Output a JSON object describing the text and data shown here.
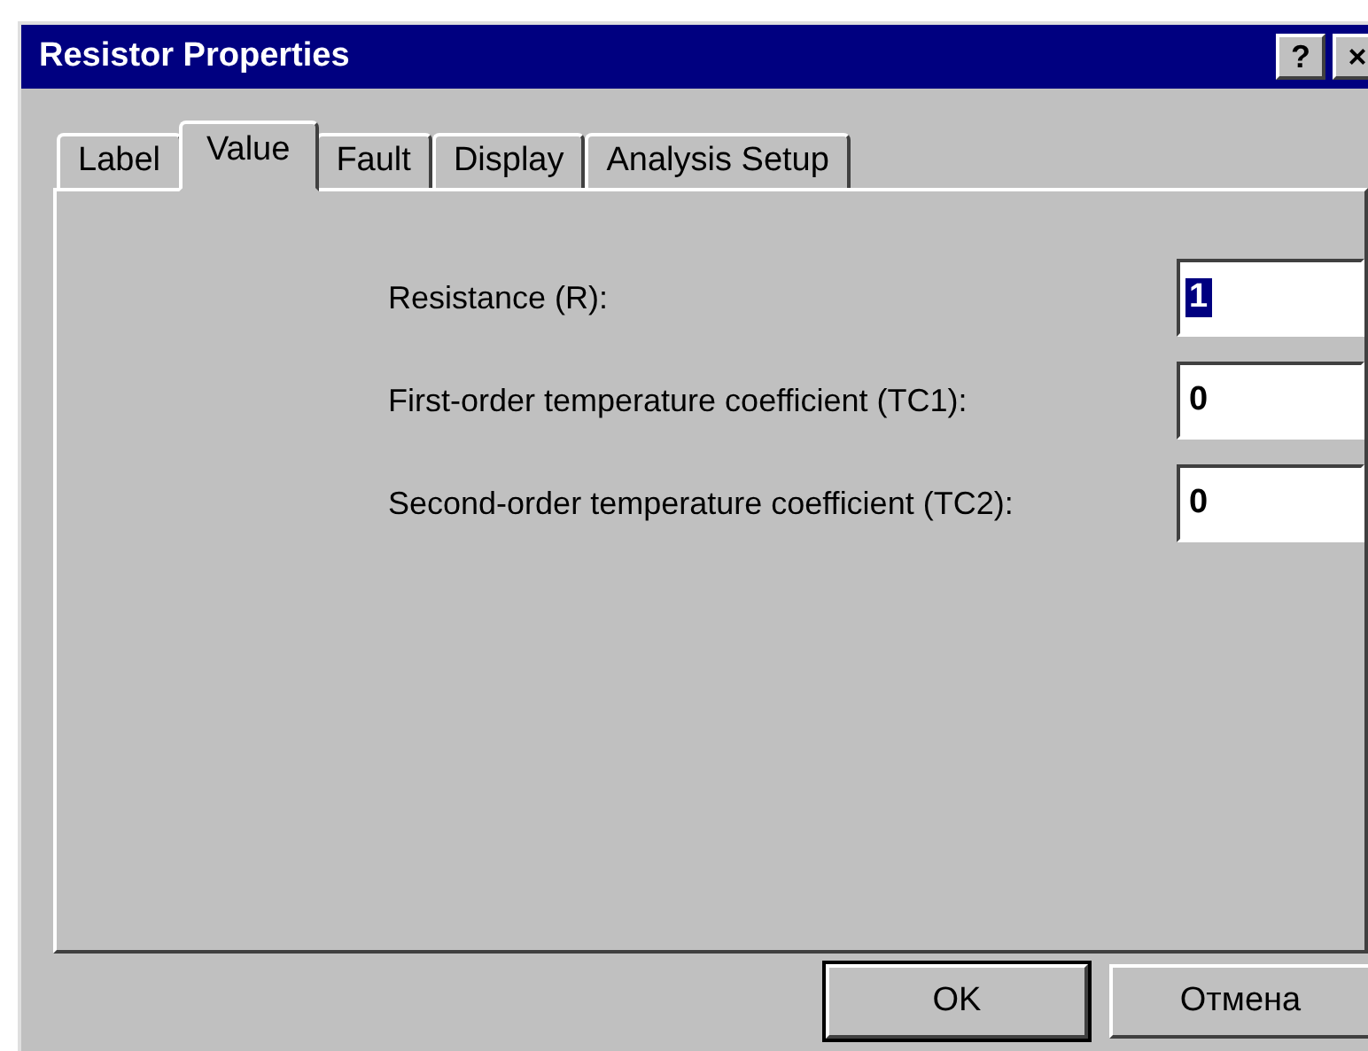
{
  "window": {
    "title": "Resistor Properties",
    "title_buttons": [
      "?",
      "×"
    ]
  },
  "tabs": [
    {
      "label": "Label",
      "selected": false
    },
    {
      "label": "Value",
      "selected": true
    },
    {
      "label": "Fault",
      "selected": false
    },
    {
      "label": "Display",
      "selected": false
    },
    {
      "label": "Analysis Setup",
      "selected": false
    }
  ],
  "fields": [
    {
      "label": "Resistance (R):",
      "value": "1",
      "selected": true
    },
    {
      "label": "First-order temperature coefficient (TC1):",
      "value": "0",
      "selected": false
    },
    {
      "label": "Second-order temperature coefficient (TC2):",
      "value": "0",
      "selected": false
    }
  ],
  "buttons": [
    {
      "label": "OK",
      "default": true
    },
    {
      "label": "Отмена",
      "default": false
    }
  ]
}
